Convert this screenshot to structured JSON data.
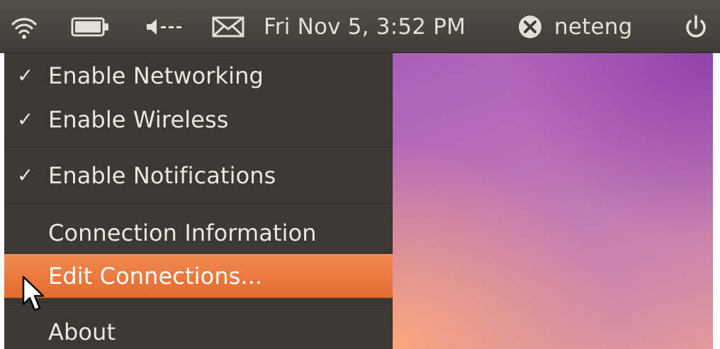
{
  "panel": {
    "datetime": "Fri Nov 5, 3:52 PM",
    "username": "neteng",
    "icons": [
      "wifi-icon",
      "battery-icon",
      "volume-icon",
      "mail-icon",
      "user-status-icon",
      "power-icon"
    ]
  },
  "menu": {
    "items": [
      {
        "label": "Enable Networking",
        "checked": true
      },
      {
        "label": "Enable Wireless",
        "checked": true
      },
      {
        "label": "Enable Notifications",
        "checked": true
      },
      {
        "label": "Connection Information",
        "checked": false
      },
      {
        "label": "Edit Connections...",
        "checked": false,
        "selected": true
      },
      {
        "label": "About",
        "checked": false
      }
    ],
    "check_glyph": "✓"
  },
  "colors": {
    "panel": "#4a4640",
    "menu": "#3c3934",
    "highlight": "#e8733a",
    "text": "#ebe7df"
  }
}
